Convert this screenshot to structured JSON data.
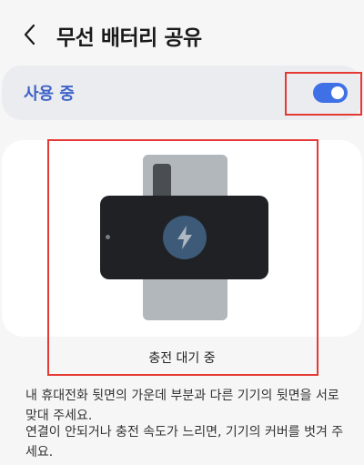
{
  "header": {
    "back_icon": "chevron-left-icon",
    "title": "무선 배터리 공유"
  },
  "toggle": {
    "label": "사용 중",
    "state": "on",
    "accent_color": "#3f70e6"
  },
  "illustration": {
    "status_text": "충전 대기 중",
    "icon": "lightning-bolt-icon"
  },
  "description": {
    "line1": "내 휴대전화 뒷면의 가운데 부분과 다른 기기의 뒷면을 서로 맞대 주세요.",
    "line2": "연결이 안되거나 충전 속도가 느리면, 기기의 커버를 벗겨 주세요."
  }
}
